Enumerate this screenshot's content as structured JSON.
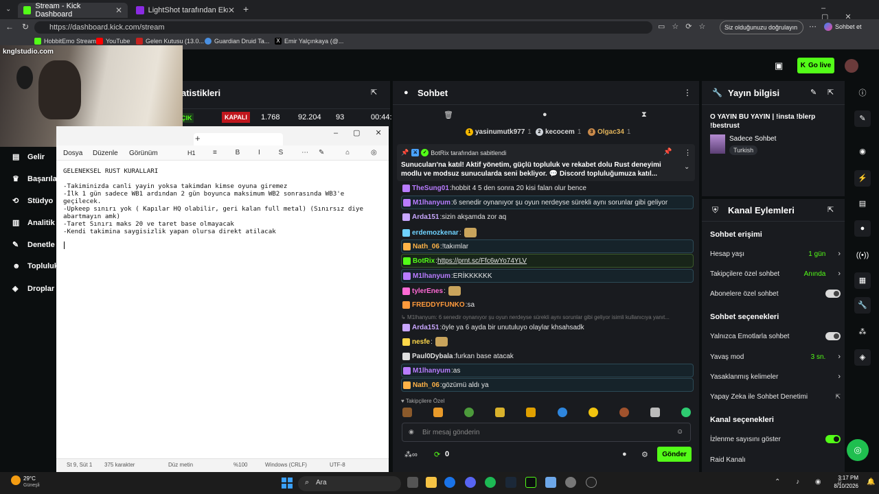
{
  "browser": {
    "tabs": [
      {
        "label": "Stream - Kick Dashboard",
        "active": true
      },
      {
        "label": "LightShot tarafından Ekran Görün",
        "active": false
      }
    ],
    "url": "https://dashboard.kick.com/stream",
    "bookmarks": [
      "HobbitEmo Stream",
      "YouTube",
      "Gelen Kutusu (13.0...",
      "Guardian Druid Ta...",
      "Emir Yalçınkaya (@..."
    ],
    "verify_label": "Siz olduğunuzu doğrulayın",
    "chat_btn": "Sohbet et"
  },
  "webcam": {
    "watermark": "knglstudio.com"
  },
  "header": {
    "go_live": "Go live"
  },
  "stats": {
    "title": "atistikleri",
    "status_open": "ÇIK",
    "status_closed": "KAPALI",
    "values": [
      "1.768",
      "92.204",
      "93",
      "00:44:"
    ]
  },
  "nav": {
    "items": [
      "Gelir",
      "Başarıla",
      "Stüdyo",
      "Analitik",
      "Denetle",
      "Topluluk",
      "Droplar"
    ]
  },
  "notepad": {
    "menu": [
      "Dosya",
      "Düzenle",
      "Görünüm"
    ],
    "heading": "H1",
    "text": "GELENEKSEL RUST KURALLARI\n\n-Takiminizda canli yayin yoksa takimdan kimse oyuna giremez\n-İlk 1 gün sadece WB1 ardından 2 gün boyunca maksimum WB2 sonrasında WB3'e geçilecek.\n-Upkeep sınırı yok ( Kapılar HQ olabilir, geri kalan full metal) (Sınırsız diye abartmayın amk)\n-Taret Sınırı maks 20 ve taret base olmayacak\n-Kendi takimina saygisizlik yapan olursa direkt atilacak",
    "status": [
      "St 9, Süt 1",
      "375 karakter",
      "Düz metin",
      "%100",
      "Windows (CRLF)",
      "UTF-8"
    ]
  },
  "chat": {
    "title": "Sohbet",
    "top_gifters": [
      {
        "name": "yasinumutk977",
        "count": "1"
      },
      {
        "name": "kecocem",
        "count": "1"
      },
      {
        "name": "Olgac34",
        "count": "1"
      }
    ],
    "pinned_by": "BotRix tarafından sabitlendi",
    "pinned_text": "Sunucuları'na katıl! Aktif yönetim, güçlü topluluk ve rekabet dolu Rust deneyimi modlu ve modsuz sunucularda seni bekliyor. 💬 Discord topluluğumuza katıl...",
    "messages": [
      {
        "user": "TheSung01",
        "text": "hobbit 4 5 den sonra 20 kisi falan olur bence",
        "color": "#b97cff",
        "style": "plain"
      },
      {
        "user": "M1lhanyum",
        "text": "6 senedir oynanıyor şu oyun nerdeyse sürekli aynı sorunlar gibi geliyor",
        "color": "#b97cff",
        "style": "hl"
      },
      {
        "user": "Arda151",
        "text": "sizin akşamda zor aq",
        "color": "#c9a7ff",
        "style": "plain"
      },
      {
        "user": "erdemozkenar",
        "text": "",
        "color": "#6fd2ff",
        "style": "plain"
      },
      {
        "user": "Nath_06",
        "text": "!takımlar",
        "color": "#ffb347",
        "style": "hl"
      },
      {
        "user": "BotRix",
        "text": "https://prnt.sc/Ffc6wYo74YLV",
        "color": "#53fc18",
        "style": "hl2"
      },
      {
        "user": "M1lhanyum",
        "text": "ERİKKKKKK",
        "color": "#b97cff",
        "style": "hl"
      },
      {
        "user": "tylerEnes",
        "text": "",
        "color": "#ff6ad5",
        "style": "plain"
      },
      {
        "user": "FREDDYFUNKO",
        "text": "sa",
        "color": "#ff9a3c",
        "style": "plain"
      },
      {
        "user": "Arda151",
        "text": "öyle ya 6 ayda bir unutuluyo olaylar khsahsadk",
        "color": "#c9a7ff",
        "style": "plain"
      },
      {
        "user": "nesfe",
        "text": "",
        "color": "#ffd84a",
        "style": "plain"
      },
      {
        "user": "Paul0Dybala",
        "text": "furkan base atacak",
        "color": "#e0e0e0",
        "style": "plain"
      },
      {
        "user": "M1lhanyum",
        "text": "as",
        "color": "#b97cff",
        "style": "hl"
      },
      {
        "user": "Nath_06",
        "text": "gözümü aldı ya",
        "color": "#ffb347",
        "style": "hl"
      }
    ],
    "reply_preview": "M1lhanyum: 6 senedir oynanıyor şu oyun nerdeyse sürekli aynı sorunlar gibi geliyor isimli kullanıcıya yanıt...",
    "followers_only": "Takipçilere Özel",
    "input_placeholder": "Bir mesaj gönderin",
    "points": "0",
    "send": "Gönder"
  },
  "stream_info": {
    "title": "Yayın bilgisi",
    "stream_title": "O YAYIN BU YAYIN | !insta !blerp !bestrust",
    "category": "Sadece Sohbet",
    "language": "Turkish"
  },
  "channel_actions": {
    "title": "Kanal Eylemleri",
    "chat_access": "Sohbet erişimi",
    "account_age": {
      "label": "Hesap yaşı",
      "value": "1 gün"
    },
    "followers_chat": {
      "label": "Takipçilere özel sohbet",
      "value": "Anında"
    },
    "subs_chat": {
      "label": "Abonelere özel sohbet"
    },
    "chat_options": "Sohbet seçenekleri",
    "emote_only": {
      "label": "Yalnızca Emotlarla sohbet"
    },
    "slow_mode": {
      "label": "Yavaş mod",
      "value": "3 sn."
    },
    "banned_words": {
      "label": "Yasaklanmış kelimeler"
    },
    "ai_moderation": {
      "label": "Yapay Zeka ile Sohbet Denetimi"
    },
    "channel_options": "Kanal seçenekleri",
    "show_viewers": {
      "label": "İzlenme sayısını göster"
    },
    "raid": {
      "label": "Raid Kanalı"
    }
  },
  "taskbar": {
    "weather_temp": "29°C",
    "weather_desc": "Güneşli",
    "search": "Ara",
    "time": "3:17 PM",
    "date": "8/10/2026"
  }
}
